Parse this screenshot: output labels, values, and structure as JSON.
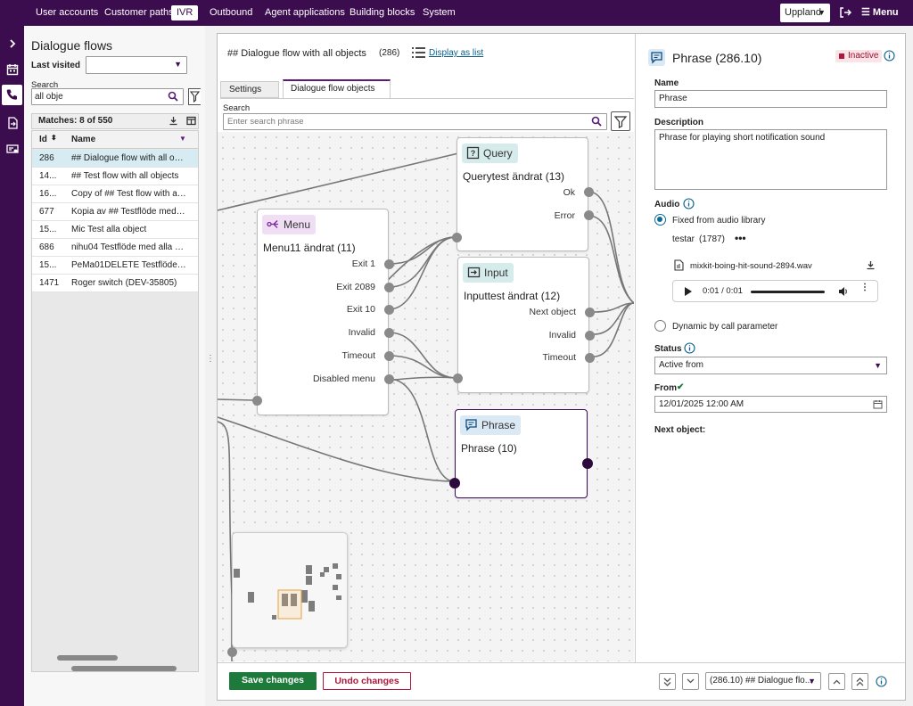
{
  "topnav": {
    "items": [
      "User accounts",
      "Customer paths",
      "IVR",
      "Outbound",
      "Agent applications",
      "Building blocks",
      "System"
    ],
    "active": "IVR",
    "region": "Uppland",
    "menu_label": "Menu"
  },
  "list_panel": {
    "title": "Dialogue flows",
    "last_visited_label": "Last visited",
    "search_label": "Search",
    "search_value": "all obje",
    "matches": "Matches: 8 of 550",
    "columns": [
      "Id",
      "Name"
    ],
    "rows": [
      {
        "id": "286",
        "name": "## Dialogue flow with all obj..."
      },
      {
        "id": "14...",
        "name": "## Test flow with all objects"
      },
      {
        "id": "16...",
        "name": "Copy of ## Test flow with all ..."
      },
      {
        "id": "677",
        "name": "Kopia av ## Testflöde med al..."
      },
      {
        "id": "15...",
        "name": "Mic Test alla object"
      },
      {
        "id": "686",
        "name": "nihu04 Testflöde med alla obj..."
      },
      {
        "id": "15...",
        "name": "PeMa01DELETE Testflöde me..."
      },
      {
        "id": "1471",
        "name": "Roger switch (DEV-35805)"
      }
    ]
  },
  "flow_header": {
    "title": "## Dialogue flow with all objects",
    "id": "(286)",
    "display_as_list": "Display as list"
  },
  "tabs": [
    "Settings",
    "Dialogue flow objects"
  ],
  "active_tab": "Dialogue flow objects",
  "canvas_search": {
    "label": "Search",
    "placeholder": "Enter search phrase"
  },
  "nodes": {
    "query": {
      "type": "Query",
      "title": "Querytest ändrat (13)",
      "exits": [
        "Ok",
        "Error"
      ]
    },
    "menu": {
      "type": "Menu",
      "title": "Menu11 ändrat (11)",
      "exits": [
        "Exit 1",
        "Exit 2089",
        "Exit 10",
        "Invalid",
        "Timeout",
        "Disabled menu"
      ]
    },
    "input": {
      "type": "Input",
      "title": "Inputtest ändrat (12)",
      "exits": [
        "Next object",
        "Invalid",
        "Timeout"
      ]
    },
    "phrase": {
      "type": "Phrase",
      "title": "Phrase (10)"
    }
  },
  "detail": {
    "title": "Phrase (286.10)",
    "status_badge": "Inactive",
    "name_label": "Name",
    "name_value": "Phrase",
    "description_label": "Description",
    "description_value": "Phrase for playing short notification sound",
    "audio_label": "Audio",
    "audio_option_1": "Fixed from audio library",
    "library_name": "testar",
    "library_id": "(1787)",
    "file_name": "mixkit-boing-hit-sound-2894.wav",
    "player_time": "0:01 / 0:01",
    "audio_option_2": "Dynamic by call parameter",
    "status_label": "Status",
    "status_value": "Active from",
    "from_label": "From",
    "from_value": "12/01/2025 12:00 AM",
    "next_object_label": "Next object:"
  },
  "bottom": {
    "save": "Save changes",
    "undo": "Undo changes",
    "object_select": "(286.10) ## Dialogue flo..."
  },
  "colors": {
    "brand": "#3b0d4f",
    "save_green": "#1e7a3a",
    "undo_red": "#b0173a",
    "query_badge": "#d6ecec",
    "menu_badge": "#f0def5",
    "input_badge": "#d6ecec",
    "phrase_badge": "#dbe9f5"
  }
}
